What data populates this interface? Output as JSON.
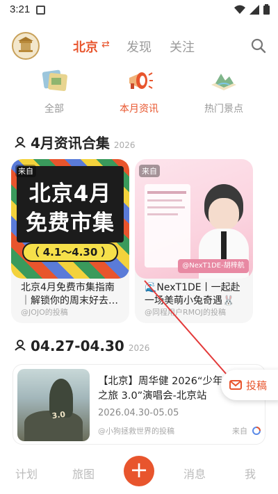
{
  "status": {
    "time": "3:21"
  },
  "header": {
    "city": "北京",
    "city_swap_icon": "⇄",
    "tabs": [
      "发现",
      "关注"
    ]
  },
  "categories": [
    {
      "label": "全部",
      "icon": "image-collage-icon"
    },
    {
      "label": "本月资讯",
      "icon": "megaphone-icon"
    },
    {
      "label": "热门景点",
      "icon": "landscape-icon"
    }
  ],
  "section1": {
    "title": "4月资讯合集",
    "year": "2026"
  },
  "cards": [
    {
      "source": "来自",
      "poster_title_line1": "北京4月",
      "poster_title_line2": "免费市集",
      "poster_date": "（ 4.1～4.30 ）",
      "title": "北京4月免费市集指南｜解锁你的周末好去…",
      "author": "@JOJO的投稿"
    },
    {
      "source": "来自",
      "poster_badge": "@NexT1DE-胡梓航",
      "title": "🌊NexT1DE丨一起赴一场美萌小兔奇遇🐰",
      "author": "@同程用户RMOJ的投稿"
    }
  ],
  "section2": {
    "title": "04.27-04.30",
    "year": "2026"
  },
  "event": {
    "title": "【北京】周华健 2026“少年的奇幻之旅 3.0”演唱会-北京站",
    "date": "2026.04.30-05.05",
    "author": "@小狗拯救世界的投稿",
    "from": "来自"
  },
  "submit": {
    "label": "投稿"
  },
  "bottom_nav": [
    "计划",
    "旅图",
    "消息",
    "我"
  ],
  "colors": {
    "accent": "#e8552d"
  }
}
